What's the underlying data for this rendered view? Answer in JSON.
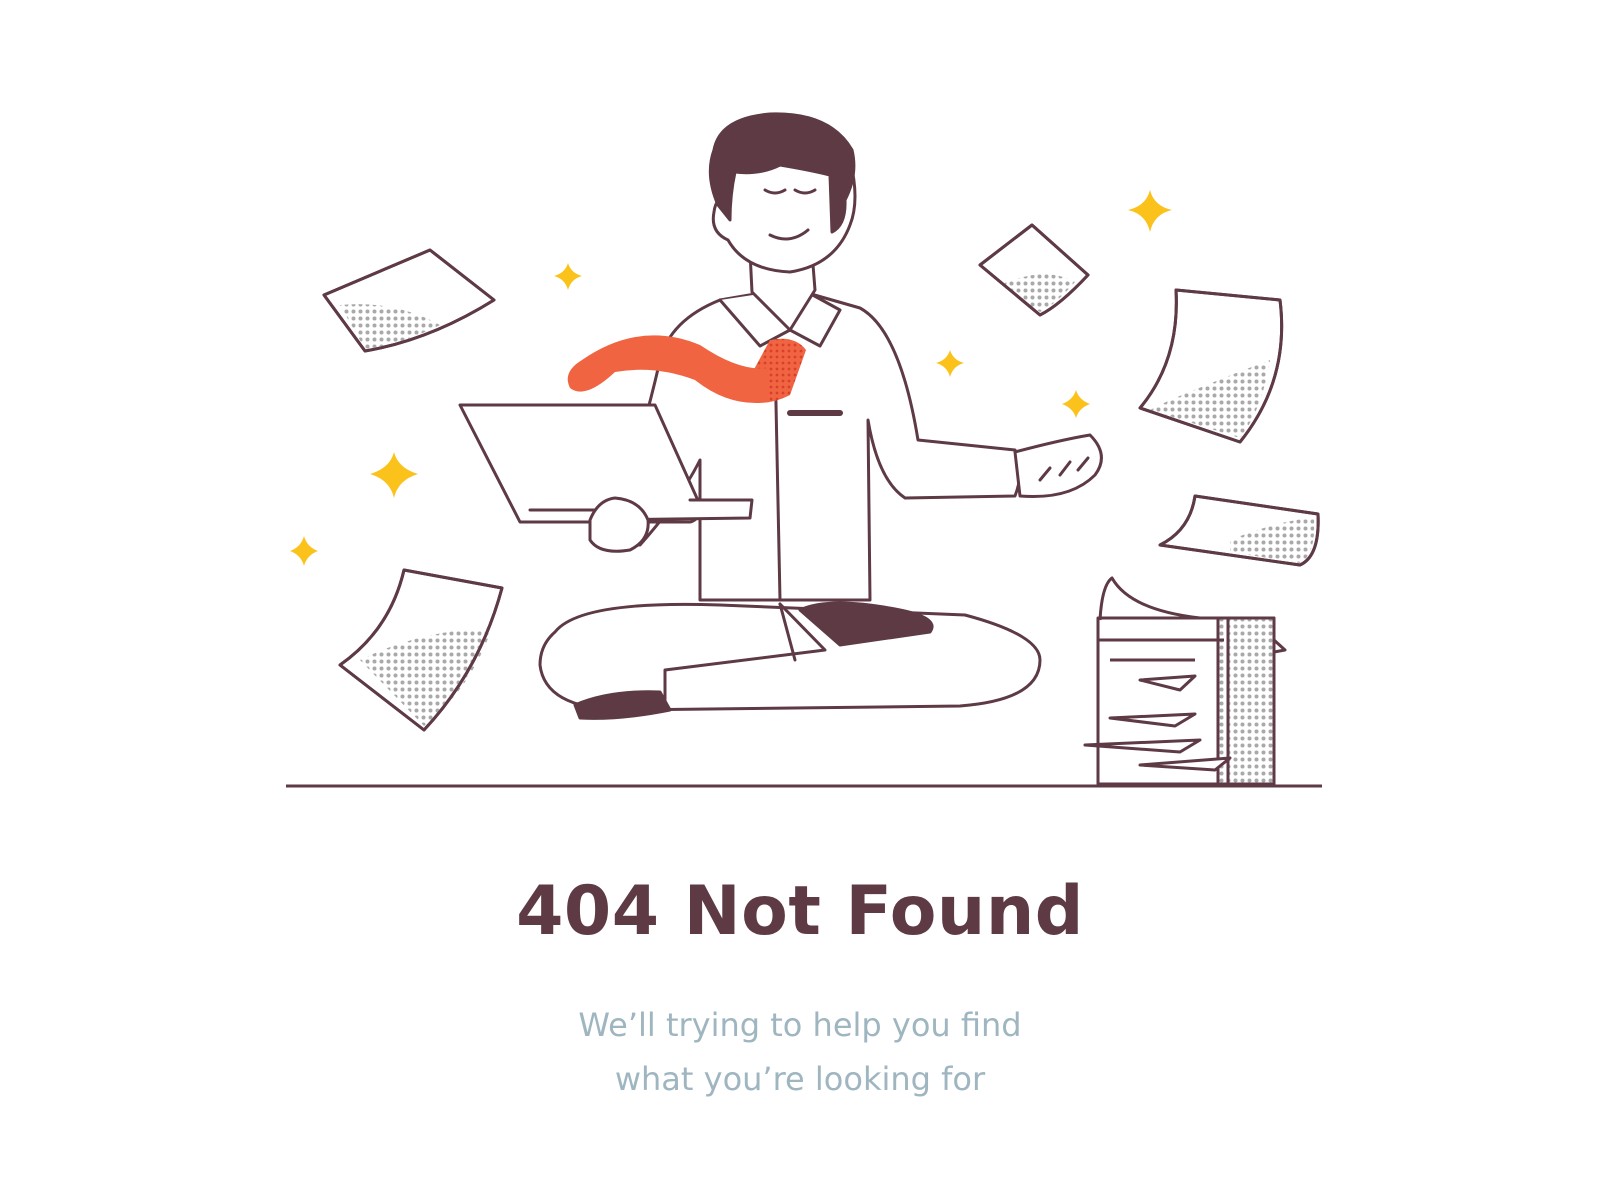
{
  "colors": {
    "ink": "#5e3a44",
    "accent": "#f06442",
    "star": "#fbc21b",
    "paper_shade": "#b4b4b4",
    "skin": "#ffffff",
    "hair": "#5e3a44",
    "subtitle": "#9fb6c1",
    "background": "#ffffff"
  },
  "illustration": {
    "subject": "meditating-man-with-laptop-icon",
    "elements": [
      "floating-paper-icon",
      "sparkle-star-icon",
      "paper-stack-icon",
      "laptop-icon",
      "necktie-icon"
    ]
  },
  "message": {
    "title": "404 Not Found",
    "subtitle_line1": "We’ll trying to help you find",
    "subtitle_line2": "what you’re looking for"
  }
}
